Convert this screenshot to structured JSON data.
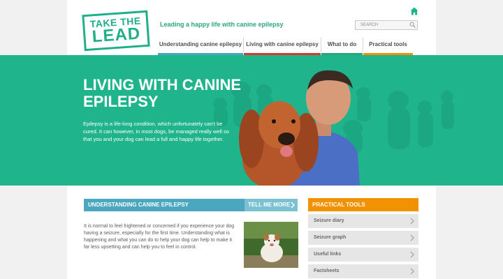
{
  "header": {
    "logo": {
      "line1": "TAKE THE",
      "line2": "LEAD"
    },
    "tagline": "Leading a happy life with canine epilepsy",
    "search_placeholder": "SEARCH"
  },
  "nav": {
    "items": [
      {
        "label": "Understanding canine epilepsy",
        "color": "#4aa7bf"
      },
      {
        "label": "Living with canine epilepsy",
        "color": "#d9372f"
      },
      {
        "label": "What to do",
        "color": "#2aa67f"
      },
      {
        "label": "Practical tools",
        "color": "#f29200"
      }
    ]
  },
  "hero": {
    "title": "LIVING WITH CANINE EPILEPSY",
    "text": "Epilepsy is a life-long condition, which unfortunately can't be cured. It can however, in most dogs, be managed really well so that you and your dog can lead a full and happy life together."
  },
  "understanding": {
    "heading": "UNDERSTANDING CANINE EPILEPSY",
    "button": "TELL ME MORE",
    "text": "It is normal to feel frightened or concerned if you experience your dog having a seizure, especially for the first time. Understanding what is happening and what you can do to help your dog can help to make it far less upsetting and can help you to feel in control."
  },
  "practical_tools": {
    "heading": "PRACTICAL TOOLS",
    "items": [
      "Seizure diary",
      "Seizure graph",
      "Useful links",
      "Factsheets"
    ]
  },
  "colors": {
    "brand_green": "#20b48d",
    "blue": "#4aa7bf",
    "orange": "#f29200"
  }
}
